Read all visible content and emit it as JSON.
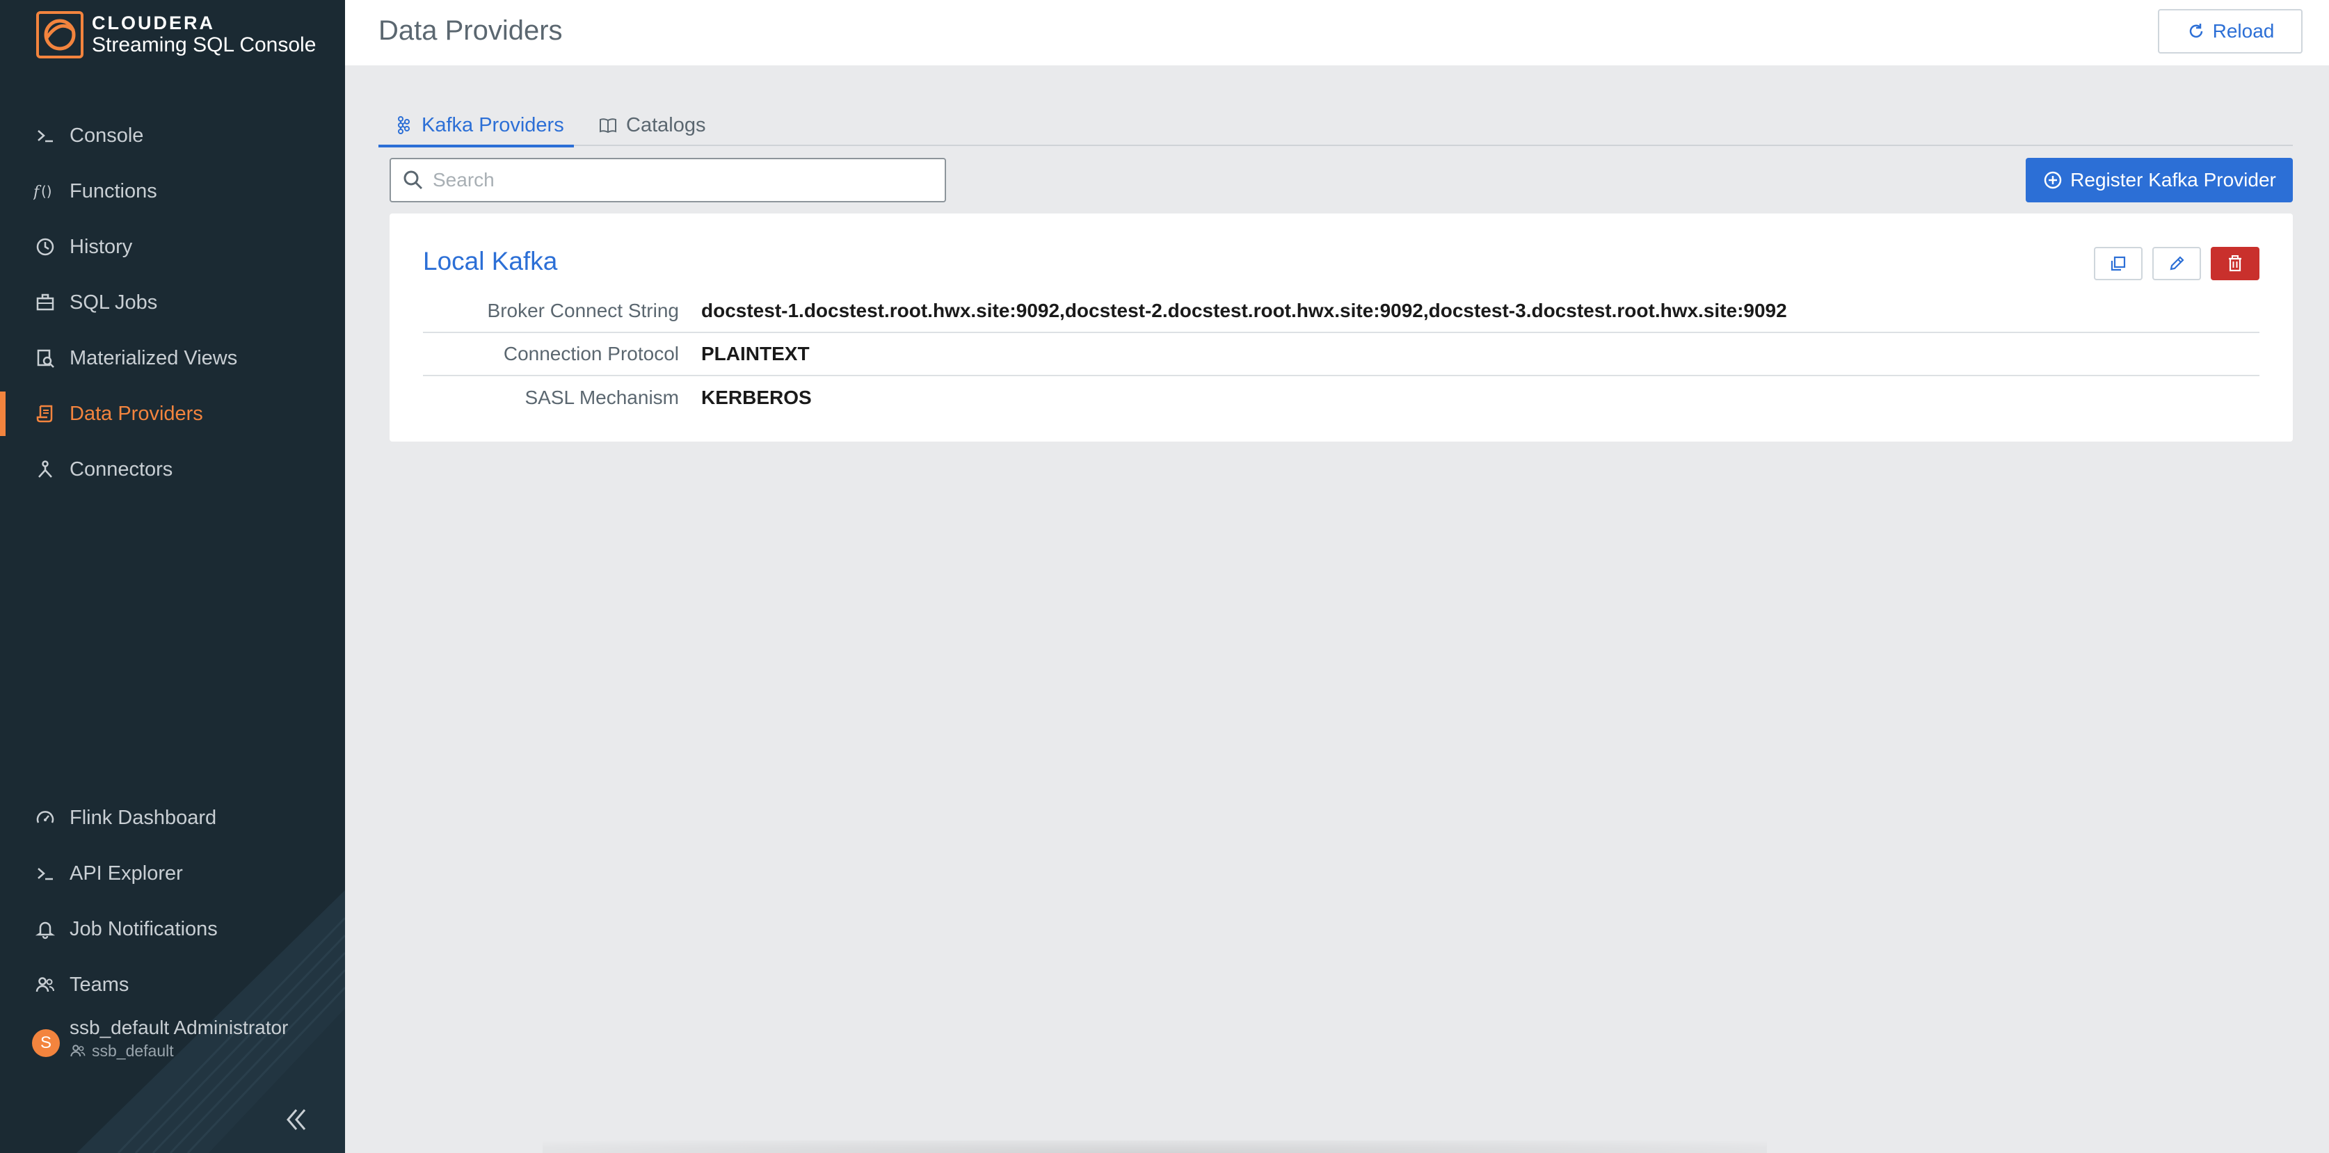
{
  "app": {
    "brand_name": "CLOUDERA",
    "product_name": "Streaming SQL Console",
    "accent_color": "#f3843e",
    "primary_color": "#2c6fd6",
    "danger_color": "#c9302c"
  },
  "sidebar": {
    "items": [
      {
        "label": "Console",
        "icon": "terminal-icon"
      },
      {
        "label": "Functions",
        "icon": "function-icon"
      },
      {
        "label": "History",
        "icon": "history-icon"
      },
      {
        "label": "SQL Jobs",
        "icon": "briefcase-icon"
      },
      {
        "label": "Materialized Views",
        "icon": "search-document-icon"
      },
      {
        "label": "Data Providers",
        "icon": "data-providers-icon",
        "active": true
      },
      {
        "label": "Connectors",
        "icon": "connector-icon"
      }
    ],
    "bottom_items": [
      {
        "label": "Flink Dashboard",
        "icon": "gauge-icon"
      },
      {
        "label": "API Explorer",
        "icon": "terminal-icon"
      },
      {
        "label": "Job Notifications",
        "icon": "bell-icon"
      },
      {
        "label": "Teams",
        "icon": "users-icon"
      }
    ],
    "user": {
      "initial": "S",
      "name": "ssb_default Administrator",
      "team": "ssb_default"
    }
  },
  "header": {
    "title": "Data Providers",
    "reload_label": "Reload"
  },
  "tabs": [
    {
      "label": "Kafka Providers",
      "active": true
    },
    {
      "label": "Catalogs",
      "active": false
    }
  ],
  "search": {
    "placeholder": "Search",
    "value": ""
  },
  "register_label": "Register Kafka Provider",
  "provider": {
    "name": "Local Kafka",
    "properties": [
      {
        "label": "Broker Connect String",
        "value": "docstest-1.docstest.root.hwx.site:9092,docstest-2.docstest.root.hwx.site:9092,docstest-3.docstest.root.hwx.site:9092"
      },
      {
        "label": "Connection Protocol",
        "value": "PLAINTEXT"
      },
      {
        "label": "SASL Mechanism",
        "value": "KERBEROS"
      }
    ]
  }
}
